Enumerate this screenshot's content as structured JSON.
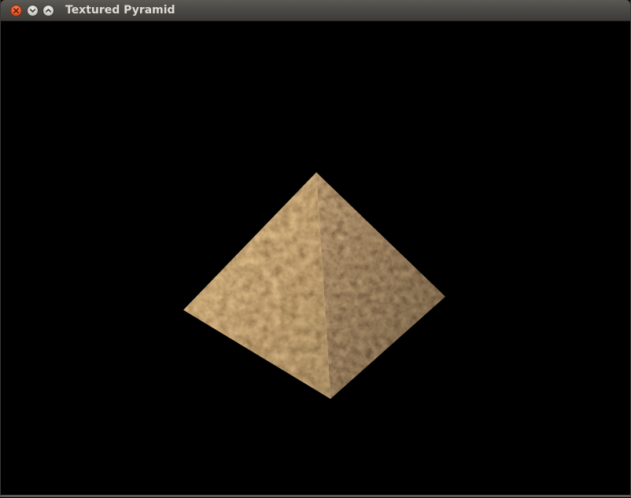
{
  "window": {
    "title": "Textured Pyramid",
    "controls": [
      "close-icon",
      "minimize-icon",
      "maximize-icon"
    ]
  },
  "scene": {
    "object": "pyramid",
    "background_color": "#000000",
    "texture_colors": [
      "#8a5a2b",
      "#b98a52",
      "#d6b68a",
      "#5e3a1a"
    ]
  }
}
